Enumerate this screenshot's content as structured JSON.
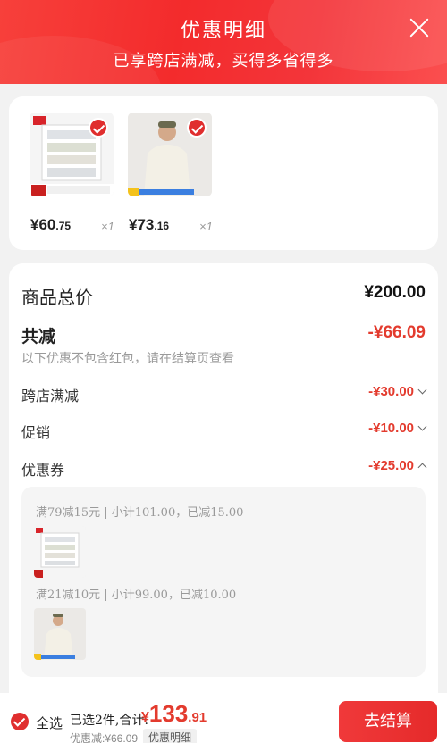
{
  "header": {
    "title": "优惠明细",
    "subtitle": "已享跨店满减，买得多省得多"
  },
  "products": [
    {
      "price_int": "¥60",
      "price_dec": ".75",
      "qty": "×1"
    },
    {
      "price_int": "¥73",
      "price_dec": ".16",
      "qty": "×1"
    }
  ],
  "summary": {
    "total_label": "商品总价",
    "total_value": "¥200.00",
    "reduce_label": "共减",
    "reduce_value": "-¥66.09",
    "note": "以下优惠不包含红包，请在结算页查看",
    "items": [
      {
        "label": "跨店满减",
        "value": "-¥30.00"
      },
      {
        "label": "促销",
        "value": "-¥10.00"
      },
      {
        "label": "优惠券",
        "value": "-¥25.00"
      }
    ]
  },
  "coupons": [
    {
      "text": "满79减15元 | 小计101.00，已减15.00"
    },
    {
      "text": "满21减10元 | 小计99.00，已减10.00"
    }
  ],
  "footer": {
    "all_label": "全选",
    "selected_text": "已选2件,合计:",
    "grand_cur": "¥",
    "grand_int": "133",
    "grand_dec": ".91",
    "discount_text": "优惠减:¥66.09",
    "detail_label": "优惠明细",
    "checkout_label": "去结算"
  },
  "colors": {
    "accent": "#e33b2e",
    "header": "#f32b2c"
  }
}
